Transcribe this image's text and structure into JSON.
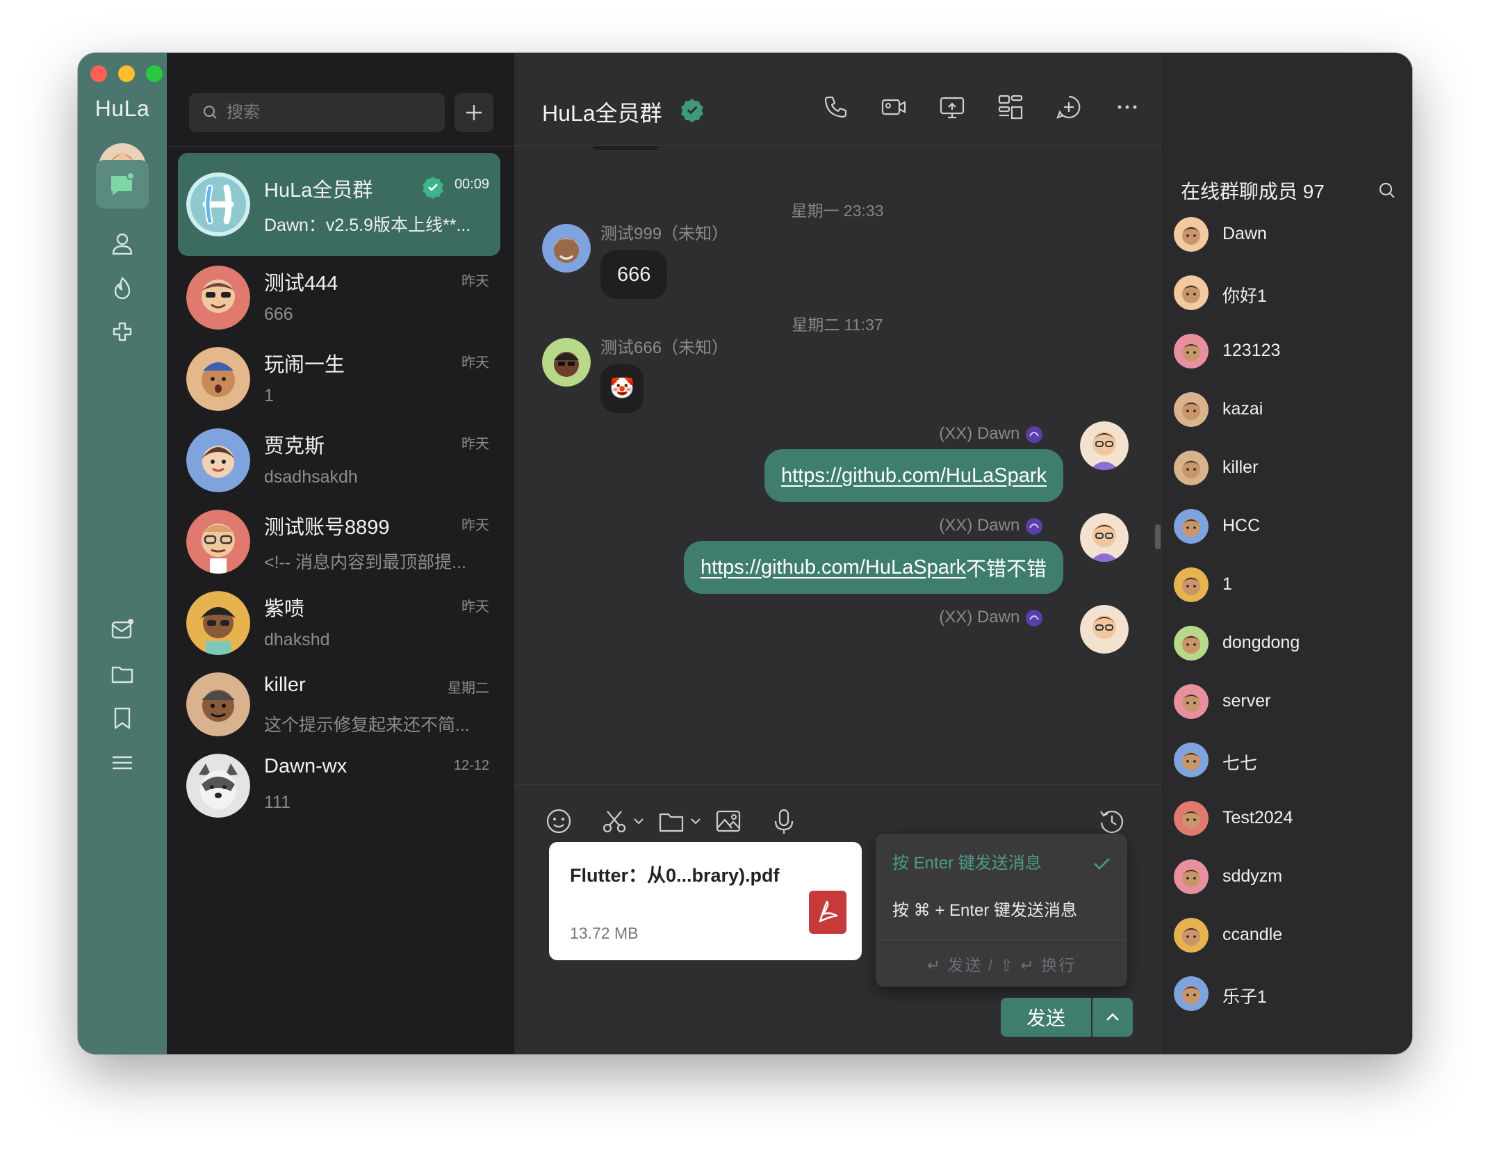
{
  "app": {
    "name": "HuLa"
  },
  "search": {
    "placeholder": "搜索"
  },
  "conversations": [
    {
      "name": "HuLa全员群",
      "time": "00:09",
      "preview": "Dawn：v2.5.9版本上线**...",
      "active": true,
      "verified": true,
      "avatar_color": "#8fc9cf"
    },
    {
      "name": "测试444",
      "time": "昨天",
      "preview": "666",
      "avatar_color": "#e07a6e"
    },
    {
      "name": "玩闹一生",
      "time": "昨天",
      "preview": "1",
      "avatar_color": "#e4b88a"
    },
    {
      "name": "贾克斯",
      "time": "昨天",
      "preview": "dsadhsakdh",
      "avatar_color": "#7fa4dd"
    },
    {
      "name": "测试账号8899",
      "time": "昨天",
      "preview": "<!-- 消息内容到最顶部提...",
      "avatar_color": "#e07a6e"
    },
    {
      "name": "紫啧",
      "time": "昨天",
      "preview": "dhakshd",
      "avatar_color": "#e6b34f"
    },
    {
      "name": "killer",
      "time": "星期二",
      "preview": "这个提示修复起来还不简...",
      "avatar_color": "#d9b28e"
    },
    {
      "name": "Dawn-wx",
      "time": "12-12",
      "preview": "111",
      "avatar_color": "#cfcfcf"
    }
  ],
  "chat": {
    "title": "HuLa全员群",
    "header_icons": [
      "phone-icon",
      "video-icon",
      "screen-share-icon",
      "layout-icon",
      "add-circle-icon",
      "more-icon"
    ],
    "timestamps": [
      "星期一 23:33",
      "星期二 11:37"
    ],
    "messages": [
      {
        "sender": "测试999（未知）",
        "text": "666",
        "side": "in"
      },
      {
        "sender": "测试666（未知）",
        "text": "🤡",
        "side": "in"
      },
      {
        "sender": "(XX) Dawn",
        "link": "https://github.com/HuLaSpark",
        "suffix": "",
        "side": "out"
      },
      {
        "sender": "(XX) Dawn",
        "link": "https://github.com/HuLaSpark",
        "suffix": " 不错不错",
        "side": "out"
      },
      {
        "sender": "(XX) Dawn",
        "side": "out"
      }
    ]
  },
  "composer": {
    "file_name": "Flutter：从0...brary).pdf",
    "file_size": "13.72 MB",
    "send_options": [
      "按 Enter 键发送消息",
      "按 ⌘ + Enter 键发送消息"
    ],
    "send_hint": "↵ 发送 / ⇧ ↵ 换行",
    "send_label": "发送"
  },
  "members": {
    "title": "在线群聊成员 97",
    "list": [
      {
        "name": "Dawn",
        "color": "#f3c9a0"
      },
      {
        "name": "你好1",
        "color": "#f3c9a0"
      },
      {
        "name": "123123",
        "color": "#e890a0"
      },
      {
        "name": "kazai",
        "color": "#d9b28e"
      },
      {
        "name": "killer",
        "color": "#d9b28e"
      },
      {
        "name": "HCC",
        "color": "#7fa4dd"
      },
      {
        "name": "1",
        "color": "#e6b34f"
      },
      {
        "name": "dongdong",
        "color": "#b8d98a"
      },
      {
        "name": "server",
        "color": "#e890a0"
      },
      {
        "name": "七七",
        "color": "#7fa4dd"
      },
      {
        "name": "Test2024",
        "color": "#e07a6e"
      },
      {
        "name": "sddyzm",
        "color": "#e890a0"
      },
      {
        "name": "ccandle",
        "color": "#e6b34f"
      },
      {
        "name": "乐子1",
        "color": "#7fa4dd"
      }
    ]
  },
  "colors": {
    "accent": "#3f7d6d",
    "rail": "#4a766d",
    "active_conv": "#3c6b60",
    "verified": "#3f9a7a"
  }
}
